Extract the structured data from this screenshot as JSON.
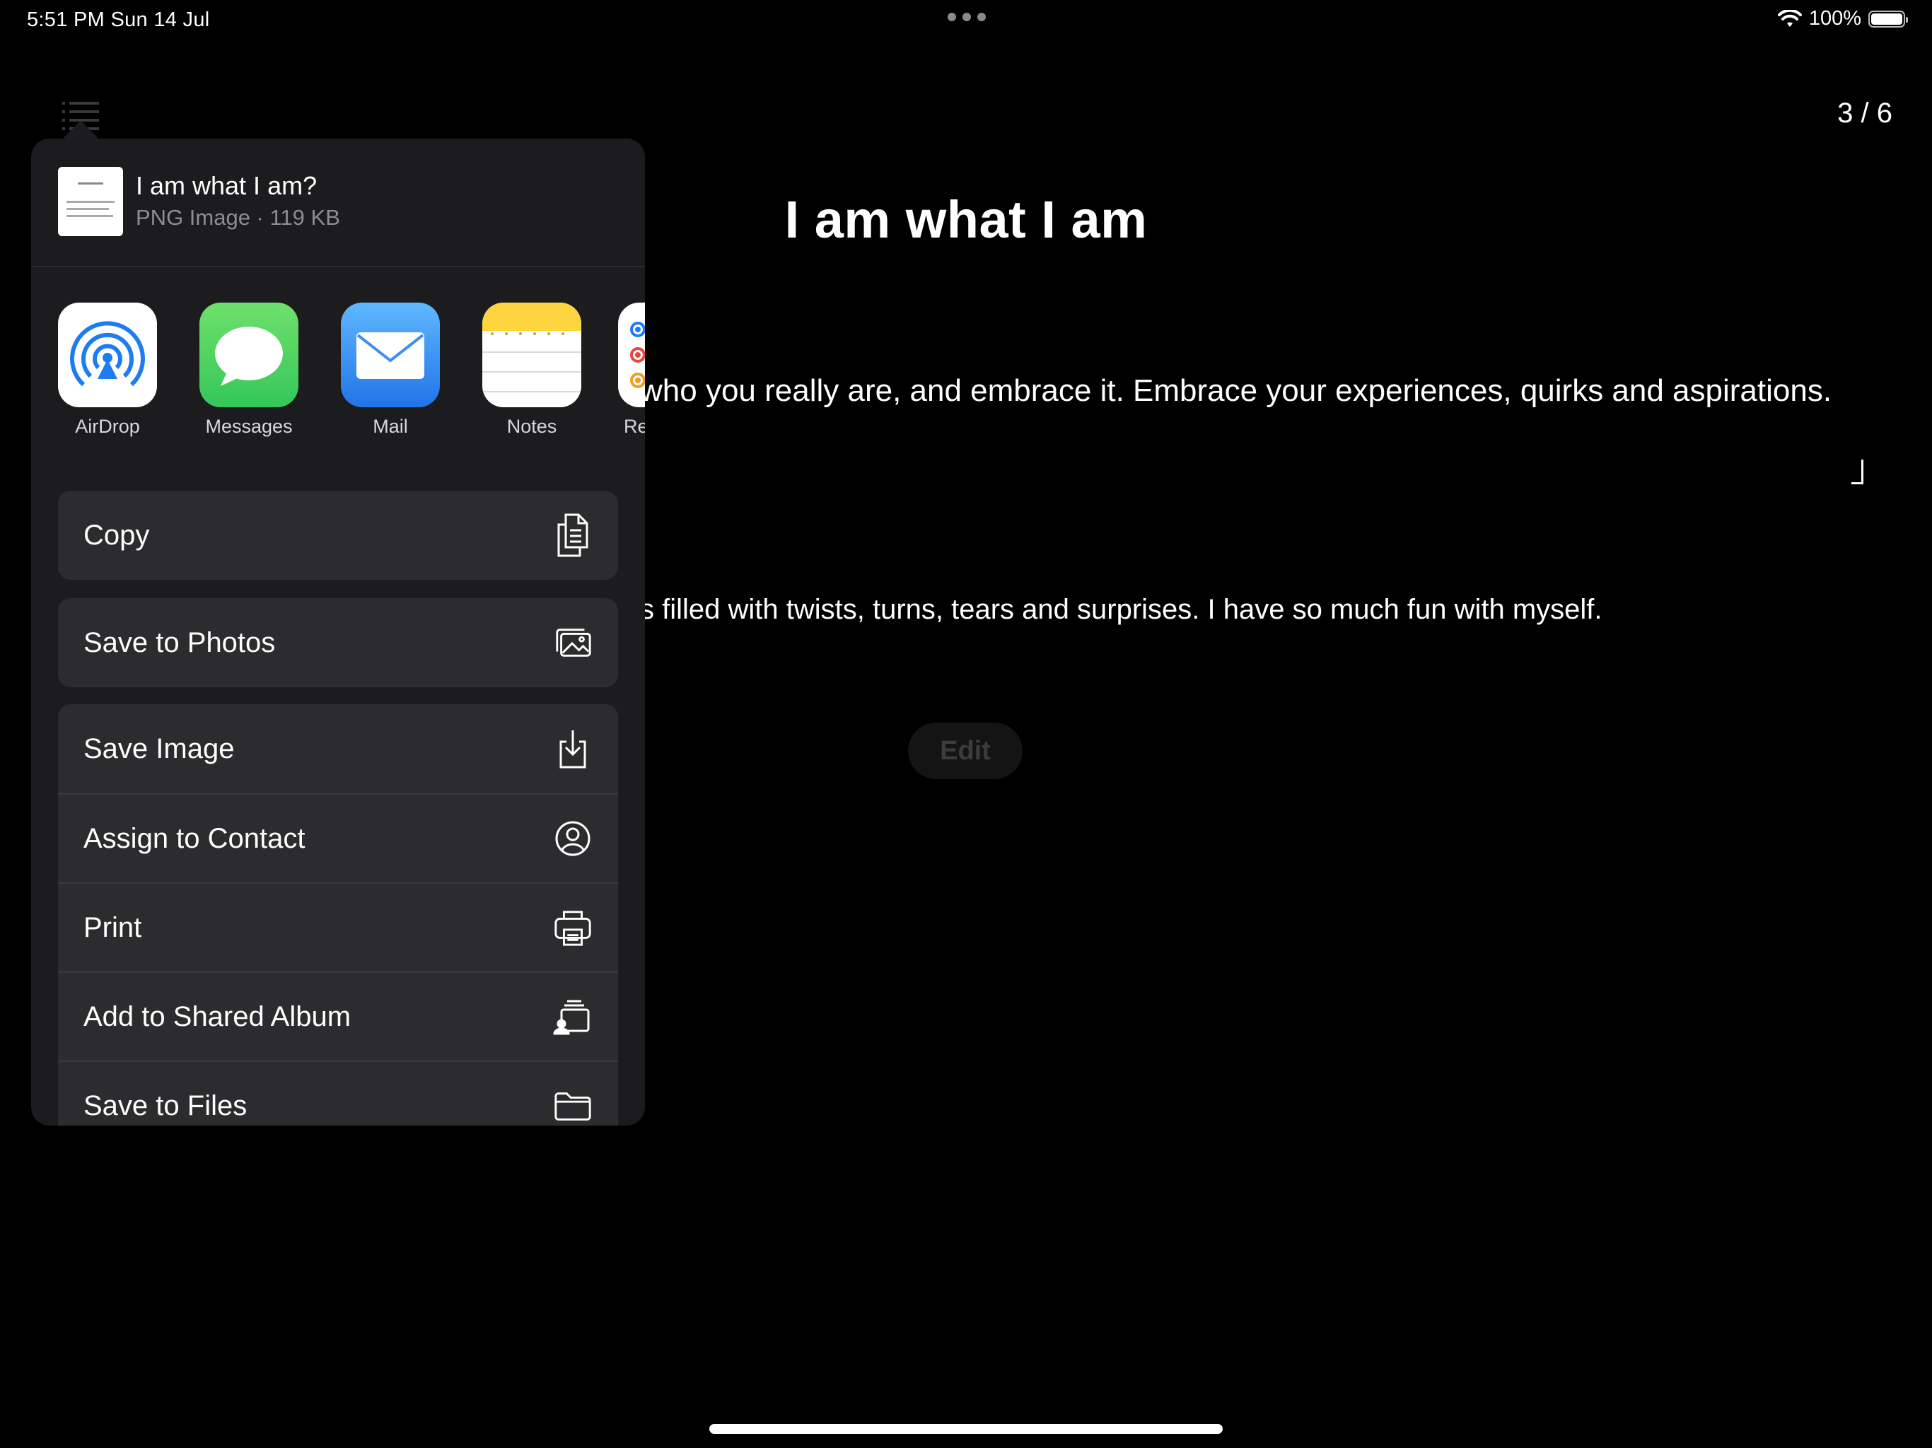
{
  "status_bar": {
    "time": "5:51 PM   Sun 14 Jul",
    "battery_text": "100%"
  },
  "document": {
    "page_indicator": "3 / 6",
    "title": "I am what I am",
    "paragraph_1": "who you really are, and embrace it. Embrace your experiences, quirks and aspirations.",
    "paragraph_2": "s filled with twists, turns, tears and surprises. I have so much fun with myself.",
    "edit_label": "Edit"
  },
  "share_sheet": {
    "file_name": "I am what I am?",
    "file_meta": "PNG Image · 119 KB",
    "apps": [
      {
        "label": "AirDrop",
        "icon": "airdrop-icon"
      },
      {
        "label": "Messages",
        "icon": "messages-icon"
      },
      {
        "label": "Mail",
        "icon": "mail-icon"
      },
      {
        "label": "Notes",
        "icon": "notes-icon"
      },
      {
        "label": "Rer",
        "icon": "reminders-icon"
      }
    ],
    "actions_group_1": [
      {
        "label": "Copy",
        "icon": "copy-icon"
      }
    ],
    "actions_group_2": [
      {
        "label": "Save to Photos",
        "icon": "photos-icon"
      }
    ],
    "actions_group_3": [
      {
        "label": "Save Image",
        "icon": "save-image-icon"
      },
      {
        "label": "Assign to Contact",
        "icon": "contact-icon"
      },
      {
        "label": "Print",
        "icon": "print-icon"
      },
      {
        "label": "Add to Shared Album",
        "icon": "shared-album-icon"
      },
      {
        "label": "Save to Files",
        "icon": "folder-icon"
      }
    ]
  },
  "colors": {
    "background": "#000000",
    "sheet": "#1c1c1e",
    "action_bg": "#2c2c2e",
    "secondary_text": "#8d8d93"
  }
}
